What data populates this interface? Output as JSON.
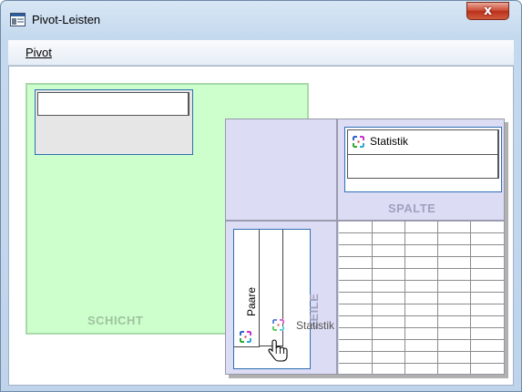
{
  "window": {
    "title": "Pivot-Leisten",
    "close_label": "x"
  },
  "menu": {
    "items": [
      {
        "label": "Pivot",
        "mnemonic": "P"
      }
    ]
  },
  "pivot": {
    "layer_label": "SCHICHT",
    "column_label": "SPALTE",
    "row_label": "ZEILE",
    "column_item": "Statistik",
    "row_item": "Paare",
    "dragged_item": "Statistik"
  },
  "colors": {
    "layer_bg": "#ccffcc",
    "pivot_bg": "#dcdcf4",
    "accent_border": "#2f6fb4"
  },
  "icons": {
    "dimension": "dimension-icon",
    "cursor": "hand-cursor-icon"
  }
}
